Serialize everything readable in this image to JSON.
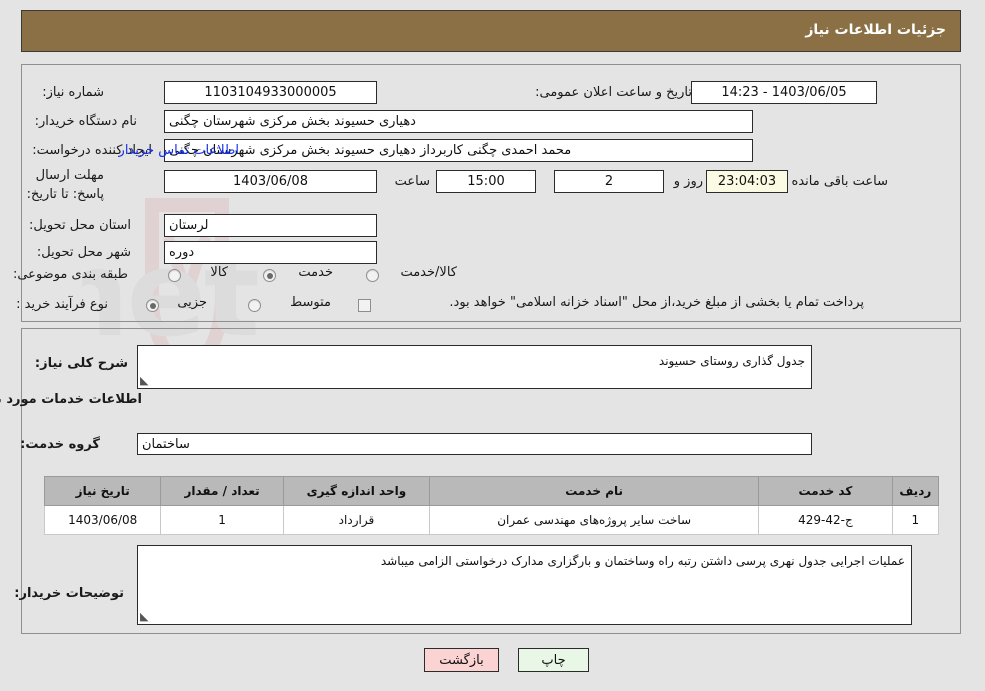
{
  "header": {
    "title": "جزئیات اطلاعات نیاز"
  },
  "top_panel": {
    "need_number": {
      "label": "شماره نیاز:",
      "value": "1103104933000005"
    },
    "buyer_org": {
      "label": "نام دستگاه خریدار:",
      "value": "دهیاری حسیوند بخش مرکزی شهرستان چگنی"
    },
    "requester": {
      "label": "ایجاد کننده درخواست:",
      "value": "محمد احمدی چگنی کاربرداز دهیاری حسیوند بخش مرکزی شهرستان چگنی"
    },
    "contact_link": "اطلاعات تماس خریدار",
    "deadline": {
      "label": "مهلت ارسال پاسخ: تا تاریخ:",
      "date": "1403/06/08"
    },
    "deadline_time": {
      "label": "ساعت",
      "value": "15:00"
    },
    "remaining_days": {
      "value": "2",
      "suffix": "روز و"
    },
    "remaining_time": {
      "value": "23:04:03",
      "suffix": "ساعت باقی مانده"
    },
    "announce": {
      "label": "تاریخ و ساعت اعلان عمومی:",
      "value": "1403/06/05 - 14:23"
    },
    "province": {
      "label": "استان محل تحویل:",
      "value": "لرستان"
    },
    "city": {
      "label": "شهر محل تحویل:",
      "value": "دوره"
    },
    "classification": {
      "label": "طبقه بندی موضوعی:",
      "options": [
        {
          "label": "کالا",
          "selected": false
        },
        {
          "label": "خدمت",
          "selected": true
        },
        {
          "label": "کالا/خدمت",
          "selected": false
        }
      ]
    },
    "purchase_type": {
      "label": "نوع فرآیند خرید :",
      "options": [
        {
          "label": "جزیی",
          "selected": true
        },
        {
          "label": "متوسط",
          "selected": false
        }
      ]
    },
    "treasury_note": {
      "checked": false,
      "text": "پرداخت تمام یا بخشی از مبلغ خرید،از محل \"اسناد خزانه اسلامی\" خواهد بود."
    }
  },
  "bottom_panel": {
    "general_description": {
      "label": "شرح کلی نیاز:",
      "value": "جدول گذاری روستای حسیوند"
    },
    "services_section_title": "اطلاعات خدمات مورد نیاز",
    "service_group": {
      "label": "گروه خدمت:",
      "value": "ساختمان"
    },
    "table": {
      "columns": [
        "ردیف",
        "کد خدمت",
        "نام خدمت",
        "واحد اندازه گیری",
        "تعداد / مقدار",
        "تاریخ نیاز"
      ],
      "rows": [
        {
          "row": "1",
          "code": "ج-42-429",
          "name": "ساخت سایر پروژه‌های مهندسی عمران",
          "unit": "قرارداد",
          "quantity": "1",
          "need_date": "1403/06/08"
        }
      ]
    },
    "buyer_notes": {
      "label": "توضیحات خریدار:",
      "value": "عملیات اجرایی جدول نهری پرسی داشتن رتبه راه وساختمان و بارگزاری مدارک درخواستی الزامی میباشد"
    }
  },
  "footer": {
    "print_label": "چاپ",
    "back_label": "بازگشت"
  },
  "watermark": {
    "text": "ArtaTender.net"
  },
  "colors": {
    "header_bg": "#8b7046",
    "page_bg": "#e4e4e4",
    "link": "#1530e8",
    "table_header_bg": "#b9b9b9",
    "countdown_bg": "#fbfbe3",
    "print_btn_bg": "#e9f7e6",
    "back_btn_bg": "#fbd3d3"
  }
}
